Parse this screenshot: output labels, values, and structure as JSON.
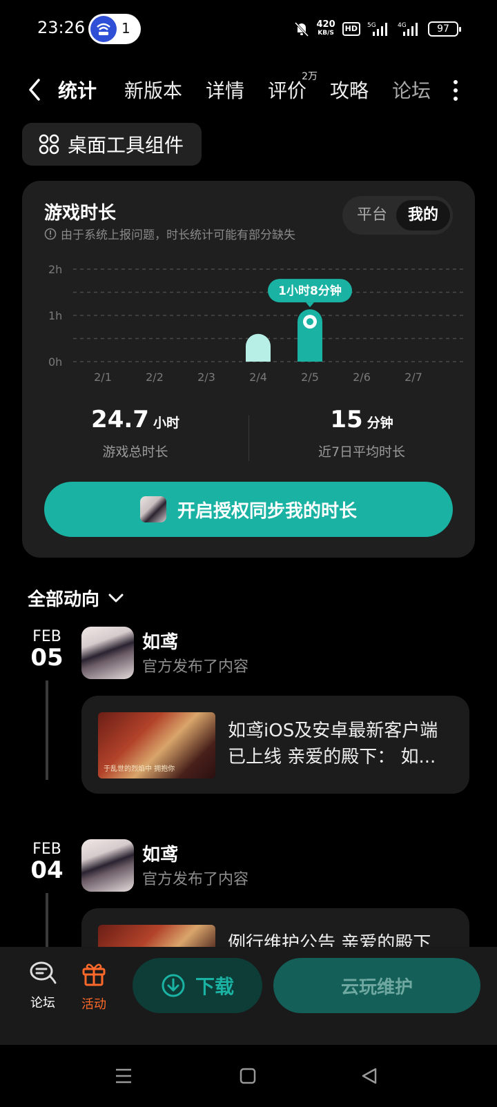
{
  "status": {
    "time": "23:26",
    "notif_count": "1",
    "net_speed": "420",
    "net_unit": "KB/S",
    "hd": "HD",
    "battery": "97"
  },
  "tabs": [
    {
      "label": "统计",
      "active": true
    },
    {
      "label": "新版本"
    },
    {
      "label": "详情"
    },
    {
      "label": "评价",
      "badge": "2万"
    },
    {
      "label": "攻略"
    },
    {
      "label": "论坛"
    }
  ],
  "widget_button": "桌面工具组件",
  "stats": {
    "title": "游戏时长",
    "note": "由于系统上报问题，时长统计可能有部分缺失",
    "toggle": {
      "platform": "平台",
      "mine": "我的"
    },
    "total": {
      "value": "24.7",
      "unit": "小时",
      "label": "游戏总时长"
    },
    "average": {
      "value": "15",
      "unit": "分钟",
      "label": "近7日平均时长"
    },
    "sync_button": "开启授权同步我的时长"
  },
  "chart_data": {
    "type": "bar",
    "categories": [
      "2/1",
      "2/2",
      "2/3",
      "2/4",
      "2/5",
      "2/6",
      "2/7"
    ],
    "values": [
      0,
      0,
      0,
      0.6,
      1.133,
      0,
      0
    ],
    "ylim": [
      0,
      2
    ],
    "yticks": [
      "0h",
      "1h",
      "2h"
    ],
    "tooltip": "1小时8分钟",
    "highlight_index": 4,
    "color": "#1ab3a3",
    "color_light": "#b7efe7"
  },
  "feed": {
    "filter": "全部动向",
    "entries": [
      {
        "month": "FEB",
        "day": "05",
        "name": "如鸢",
        "sub": "官方发布了内容",
        "line1": "如鸢iOS及安卓最新客户端",
        "line2": "已上线 亲爱的殿下：  如...",
        "thumb_caption": "于乱世的烈焰中 拥抱你"
      },
      {
        "month": "FEB",
        "day": "04",
        "name": "如鸢",
        "sub": "官方发布了内容",
        "line1": "例行维护公告 亲爱的殿下",
        "line2": "",
        "thumb_caption": ""
      }
    ]
  },
  "bottom": {
    "forum": "论坛",
    "activity": "活动",
    "download": "下载",
    "cloud": "云玩维护",
    "accent": "#ff6a2a"
  }
}
